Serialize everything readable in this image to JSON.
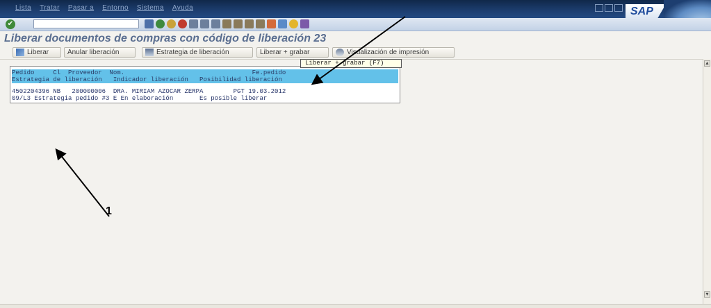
{
  "menu": [
    "Lista",
    "Tratar",
    "Pasar a",
    "Entorno",
    "Sistema",
    "Ayuda"
  ],
  "brand": "SAP",
  "title": "Liberar documentos de compras con código de liberación 23",
  "toolbar": {
    "liberar": "Liberar",
    "anular": "Anular liberación",
    "estrategia": "Estrategia de liberación",
    "liberar_grabar": "Liberar + grabar",
    "visualizacion": "Visualización de impresión"
  },
  "tooltip": "Liberar + grabar  (F7)",
  "list": {
    "header_line1": "Pedido     Cl  Proveedor  Nom.                                  Fe.pedido",
    "header_line2": "Estrategia de liberación   Indicador liberación   Posibilidad liberación",
    "row_line1": "4502204396 NB   200000006  DRA. MIRIAM AZOCAR ZERPA        PGT 19.03.2012",
    "row_line2": "09/L3 Estrategia pedido #3 E En elaboración       Es posible liberar"
  },
  "annotation_label": "1",
  "colors": {
    "menubar": "#1d3e70",
    "header_row": "#63c1e9",
    "title_text": "#5a6e90"
  }
}
